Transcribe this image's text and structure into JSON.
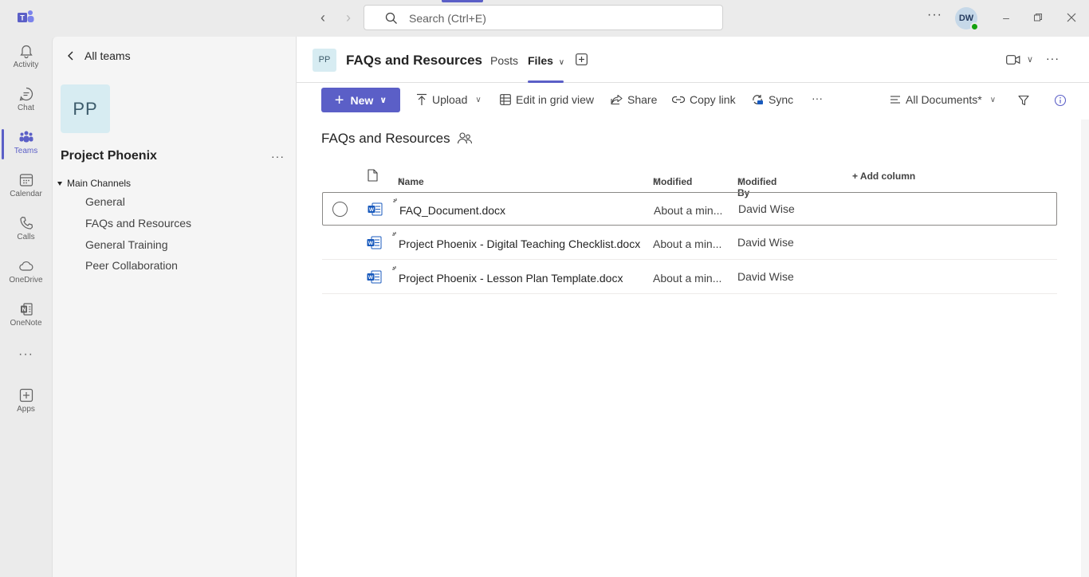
{
  "titlebar": {
    "search_placeholder": "Search (Ctrl+E)",
    "more": "···",
    "avatar_initials": "DW"
  },
  "rail": {
    "items": [
      {
        "label": "Activity",
        "icon": "bell-icon"
      },
      {
        "label": "Chat",
        "icon": "chat-icon"
      },
      {
        "label": "Teams",
        "icon": "teams-icon",
        "active": true
      },
      {
        "label": "Calendar",
        "icon": "calendar-icon"
      },
      {
        "label": "Calls",
        "icon": "phone-icon"
      },
      {
        "label": "OneDrive",
        "icon": "cloud-icon"
      },
      {
        "label": "OneNote",
        "icon": "onenote-icon"
      },
      {
        "label": "Apps",
        "icon": "add-apps-icon"
      }
    ],
    "more": "···"
  },
  "panel": {
    "back_label": "All teams",
    "team_initials": "PP",
    "team_name": "Project Phoenix",
    "team_more": "···",
    "section_label": "Main Channels",
    "channels": [
      "General",
      "FAQs and Resources",
      "General Training",
      "Peer Collaboration"
    ]
  },
  "channel_header": {
    "initials": "PP",
    "title": "FAQs and Resources",
    "tabs": [
      {
        "label": "Posts"
      },
      {
        "label": "Files",
        "active": true
      }
    ],
    "more": "···"
  },
  "toolbar": {
    "new_label": "New",
    "upload_label": "Upload",
    "grid_label": "Edit in grid view",
    "share_label": "Share",
    "copy_link_label": "Copy link",
    "sync_label": "Sync",
    "more": "···",
    "view_label": "All Documents*"
  },
  "library": {
    "title": "FAQs and Resources",
    "columns": {
      "name": "Name",
      "modified": "Modified",
      "modified_by": "Modified By",
      "add_column": "+ Add column"
    },
    "files": [
      {
        "name": "FAQ_Document.docx",
        "modified": "About a min...",
        "modified_by": "David Wise",
        "selected": true
      },
      {
        "name": "Project Phoenix - Digital Teaching Checklist.docx",
        "modified": "About a min...",
        "modified_by": "David Wise"
      },
      {
        "name": "Project Phoenix - Lesson Plan Template.docx",
        "modified": "About a min...",
        "modified_by": "David Wise"
      }
    ]
  },
  "colors": {
    "accent": "#5b5fc7",
    "word_blue": "#185abd",
    "presence_green": "#13a10e"
  }
}
